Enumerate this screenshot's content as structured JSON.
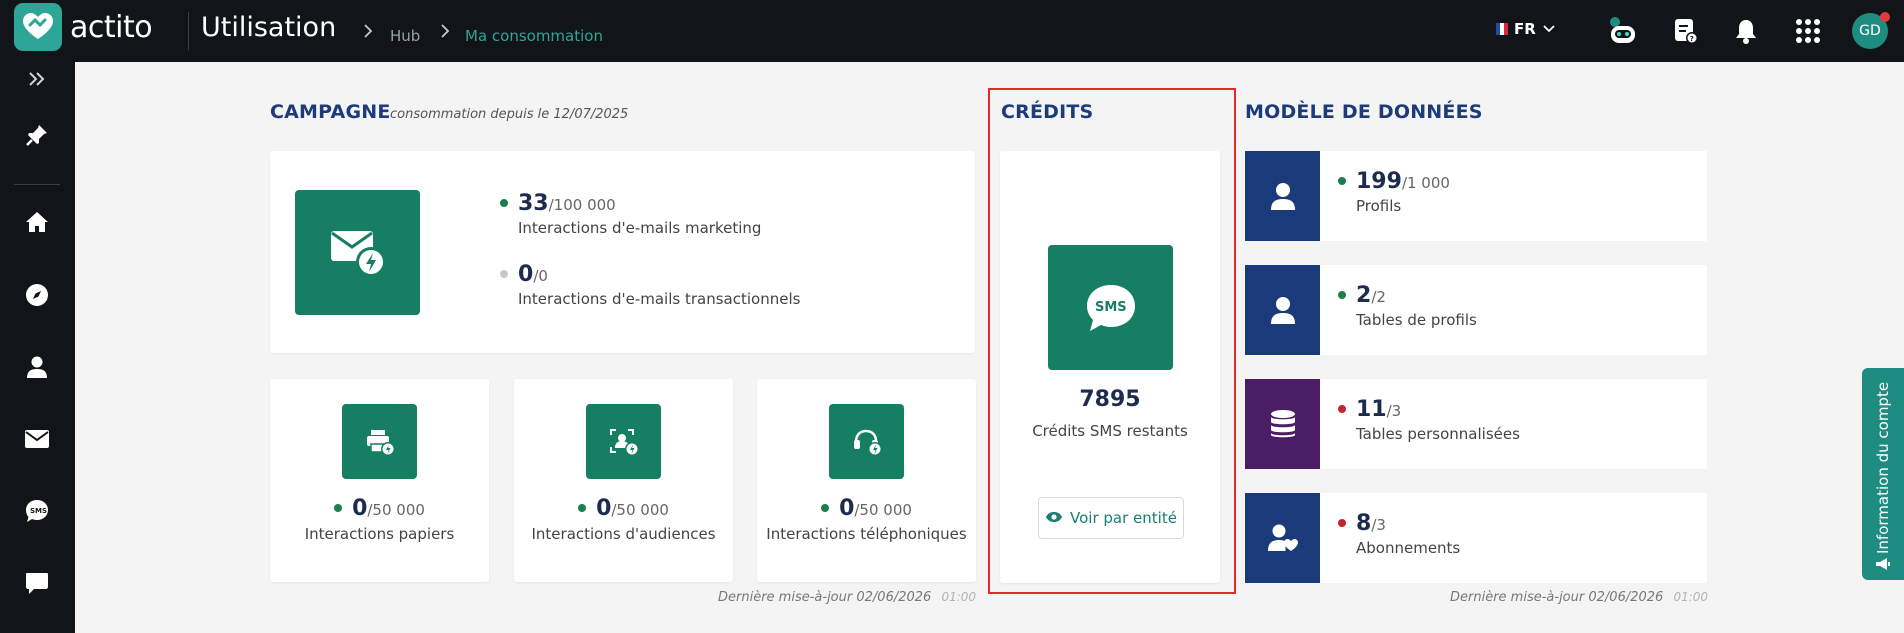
{
  "header": {
    "logo_text": "actito",
    "app_title": "Utilisation",
    "breadcrumb": [
      {
        "label": "Hub"
      },
      {
        "label": "Ma consommation"
      }
    ],
    "language": "FR",
    "avatar_initials": "GD",
    "icons": [
      "robot-assistant-icon",
      "help-document-icon",
      "notification-bell-icon",
      "apps-grid-icon"
    ]
  },
  "sidebar": {
    "items": [
      {
        "icon": "expand-chevrons-icon"
      },
      {
        "icon": "pin-icon"
      },
      {
        "icon": "home-icon"
      },
      {
        "icon": "compass-icon"
      },
      {
        "icon": "user-icon"
      },
      {
        "icon": "email-icon"
      },
      {
        "icon": "sms-icon"
      },
      {
        "icon": "chat-icon"
      }
    ]
  },
  "campagne": {
    "title": "CAMPAGNE",
    "subtitle": "consommation depuis le 12/07/2025",
    "email": {
      "marketing": {
        "value": "33",
        "limit": "/100 000",
        "label": "Interactions d'e-mails marketing",
        "status_color": "#1a7f4f"
      },
      "transactional": {
        "value": "0",
        "limit": "/0",
        "label": "Interactions d'e-mails transactionnels",
        "status_color": "#c8c8c8"
      }
    },
    "cards": [
      {
        "value": "0",
        "limit": "/50 000",
        "label": "Interactions papiers",
        "icon": "paper-print-icon"
      },
      {
        "value": "0",
        "limit": "/50 000",
        "label": "Interactions d'audiences",
        "icon": "audience-scan-icon"
      },
      {
        "value": "0",
        "limit": "/50 000",
        "label": "Interactions téléphoniques",
        "icon": "phone-headset-icon"
      }
    ],
    "updated_label": "Dernière mise-à-jour",
    "updated_date": "02/06/2026",
    "updated_time": "01:00"
  },
  "credits": {
    "title": "CRÉDITS",
    "sms_value": "7895",
    "sms_label": "Crédits SMS restants",
    "button_label": "Voir par entité"
  },
  "data_model": {
    "title": "MODÈLE DE DONNÉES",
    "items": [
      {
        "value": "199",
        "limit": "/1 000",
        "label": "Profils",
        "icon": "profile-user-icon",
        "tile_color": "#1b3a7a",
        "status_color": "#1a7f4f"
      },
      {
        "value": "2",
        "limit": "/2",
        "label": "Tables de profils",
        "icon": "profile-user-icon",
        "tile_color": "#1b3a7a",
        "status_color": "#1a7f4f"
      },
      {
        "value": "11",
        "limit": "/3",
        "label": "Tables personnalisées",
        "icon": "database-icon",
        "tile_color": "#4a1d66",
        "status_color": "#c0262f"
      },
      {
        "value": "8",
        "limit": "/3",
        "label": "Abonnements",
        "icon": "user-heart-icon",
        "tile_color": "#1b3a7a",
        "status_color": "#c0262f"
      }
    ],
    "updated_label": "Dernière mise-à-jour",
    "updated_date": "02/06/2026",
    "updated_time": "01:00"
  },
  "side_tab": {
    "label": "Information du compte"
  }
}
